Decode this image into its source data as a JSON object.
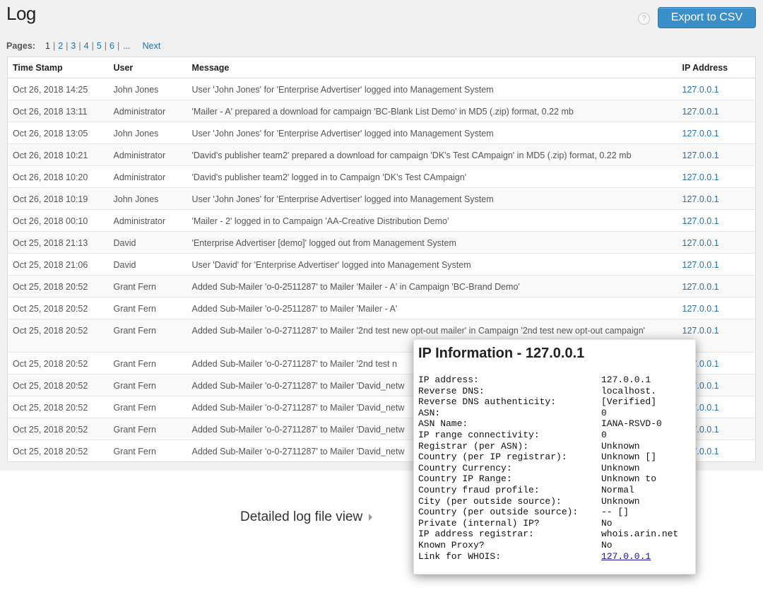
{
  "header": {
    "title": "Log",
    "help_glyph": "?",
    "export_label": "Export to CSV"
  },
  "pagination": {
    "label": "Pages:",
    "current": "1",
    "pages": [
      "2",
      "3",
      "4",
      "5",
      "6"
    ],
    "ellipsis": "...",
    "next": "Next"
  },
  "table": {
    "columns": [
      "Time Stamp",
      "User",
      "Message",
      "IP Address"
    ],
    "rows": [
      {
        "time": "Oct 26, 2018 14:25",
        "user": "John Jones",
        "message": "User 'John Jones' for 'Enterprise Advertiser' logged into Management System",
        "ip": "127.0.0.1"
      },
      {
        "time": "Oct 26, 2018 13:11",
        "user": "Administrator",
        "message": "'Mailer - A' prepared a download for campaign 'BC-Blank List Demo' in MD5 (.zip) format, 0.22 mb",
        "ip": "127.0.0.1"
      },
      {
        "time": "Oct 26, 2018 13:05",
        "user": "John Jones",
        "message": "User 'John Jones' for 'Enterprise Advertiser' logged into Management System",
        "ip": "127.0.0.1"
      },
      {
        "time": "Oct 26, 2018 10:21",
        "user": "Administrator",
        "message": "'David's publisher team2' prepared a download for campaign 'DK's Test CAmpaign' in MD5 (.zip) format, 0.22 mb",
        "ip": "127.0.0.1"
      },
      {
        "time": "Oct 26, 2018 10:20",
        "user": "Administrator",
        "message": "'David's publisher team2' logged in to Campaign 'DK's Test CAmpaign'",
        "ip": "127.0.0.1"
      },
      {
        "time": "Oct 26, 2018 10:19",
        "user": "John Jones",
        "message": "User 'John Jones' for 'Enterprise Advertiser' logged into Management System",
        "ip": "127.0.0.1"
      },
      {
        "time": "Oct 26, 2018 00:10",
        "user": "Administrator",
        "message": "'Mailer - 2' logged in to Campaign 'AA-Creative Distribution Demo'",
        "ip": "127.0.0.1"
      },
      {
        "time": "Oct 25, 2018 21:13",
        "user": "David",
        "message": "'Enterprise Advertiser [demo]' logged out from Management System",
        "ip": "127.0.0.1"
      },
      {
        "time": "Oct 25, 2018 21:06",
        "user": "David",
        "message": "User 'David' for 'Enterprise Advertiser' logged into Management System",
        "ip": "127.0.0.1"
      },
      {
        "time": "Oct 25, 2018 20:52",
        "user": "Grant Fern",
        "message": "Added Sub-Mailer 'o-0-2511287' to Mailer 'Mailer - A' in Campaign 'BC-Brand Demo'",
        "ip": "127.0.0.1"
      },
      {
        "time": "Oct 25, 2018 20:52",
        "user": "Grant Fern",
        "message": "Added Sub-Mailer 'o-0-2511287' to Mailer 'Mailer - A'",
        "ip": "127.0.0.1"
      },
      {
        "time": "Oct 25, 2018 20:52",
        "user": "Grant Fern",
        "message": "Added Sub-Mailer 'o-0-2711287' to Mailer '2nd test new opt-out mailer' in Campaign '2nd test new opt-out campaign'",
        "ip": "127.0.0.1"
      },
      {
        "time": "Oct 25, 2018 20:52",
        "user": "Grant Fern",
        "message": "Added Sub-Mailer 'o-0-2711287' to Mailer '2nd test n",
        "ip": "127.0.0.1"
      },
      {
        "time": "Oct 25, 2018 20:52",
        "user": "Grant Fern",
        "message": "Added Sub-Mailer 'o-0-2711287' to Mailer 'David_netw",
        "ip": "127.0.0.1"
      },
      {
        "time": "Oct 25, 2018 20:52",
        "user": "Grant Fern",
        "message": "Added Sub-Mailer 'o-0-2711287' to Mailer 'David_netw",
        "ip": "127.0.0.1"
      },
      {
        "time": "Oct 25, 2018 20:52",
        "user": "Grant Fern",
        "message": "Added Sub-Mailer 'o-0-2711287' to Mailer 'David_netw",
        "ip": "127.0.0.1"
      },
      {
        "time": "Oct 25, 2018 20:52",
        "user": "Grant Fern",
        "message": "Added Sub-Mailer 'o-0-2711287' to Mailer 'David_netw",
        "ip": "127.0.0.1"
      }
    ]
  },
  "caption": "Detailed log file view",
  "popup": {
    "title": "IP Information - 127.0.0.1",
    "fields": [
      {
        "key": "IP address:",
        "value": "127.0.0.1"
      },
      {
        "key": "Reverse DNS:",
        "value": "localhost."
      },
      {
        "key": "Reverse DNS authenticity:",
        "value": "[Verified]"
      },
      {
        "key": "ASN:",
        "value": "0"
      },
      {
        "key": "ASN Name:",
        "value": "IANA-RSVD-0"
      },
      {
        "key": "IP range connectivity:",
        "value": "0"
      },
      {
        "key": "Registrar (per ASN):",
        "value": "Unknown"
      },
      {
        "key": "Country (per IP registrar):",
        "value": "Unknown []"
      },
      {
        "key": "Country Currency:",
        "value": "Unknown"
      },
      {
        "key": "Country IP Range:",
        "value": "Unknown to"
      },
      {
        "key": "Country fraud profile:",
        "value": "Normal"
      },
      {
        "key": "City (per outside source):",
        "value": "Unknown"
      },
      {
        "key": "Country (per outside source):",
        "value": "-- []"
      },
      {
        "key": "Private (internal) IP?",
        "value": "No"
      },
      {
        "key": "IP address registrar:",
        "value": "whois.arin.net"
      },
      {
        "key": "Known Proxy?",
        "value": "No"
      }
    ],
    "whois_label": "Link for WHOIS:",
    "whois_link": "127.0.0.1"
  },
  "colors": {
    "accent": "#3a8fc8",
    "link": "#2271b1",
    "background": "#f1f1f1"
  }
}
